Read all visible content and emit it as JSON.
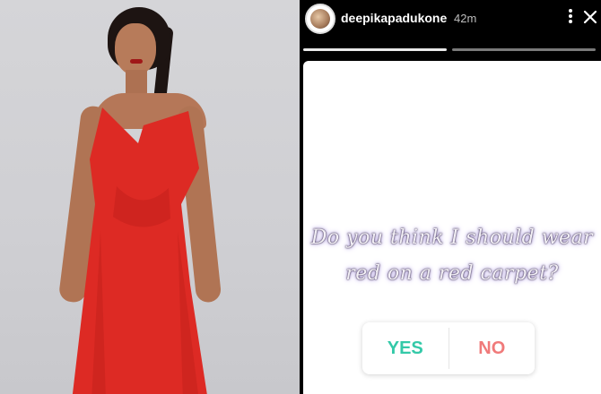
{
  "story": {
    "username": "deepikapadukone",
    "time_ago": "42m",
    "question_line1": "Do you think I should wear",
    "question_line2": "red on a red carpet?",
    "poll": {
      "yes_label": "YES",
      "no_label": "NO",
      "yes_color": "#33c9a8",
      "no_color": "#f07a7a"
    }
  },
  "icons": {
    "more": "more-vertical-icon",
    "close": "close-icon"
  },
  "colors": {
    "dress": "#dd2a24",
    "story_bg": "#000000",
    "card_bg": "#ffffff"
  }
}
